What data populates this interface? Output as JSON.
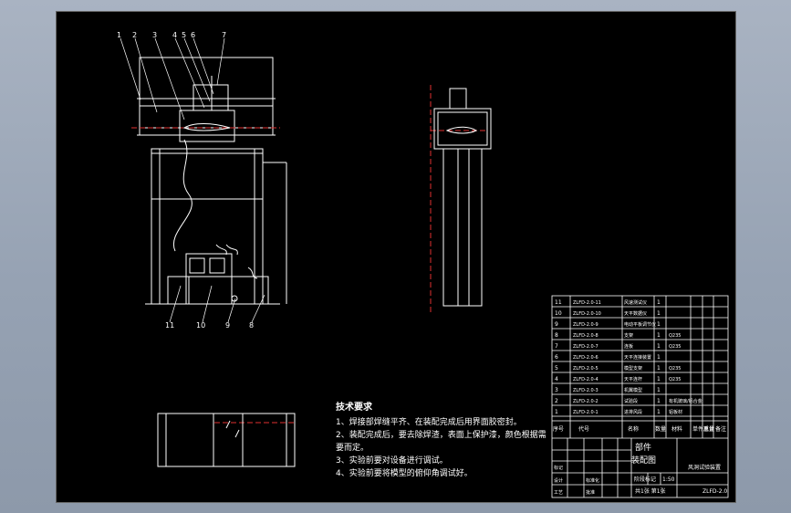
{
  "tech_requirements": {
    "title": "技术要求",
    "lines": [
      "1、焊接部焊缝平齐、在装配完成后用界面胶密封。",
      "2、装配完成后，要去除焊渣，表面上保护漆，颜色根据需",
      "要而定。",
      "3、实验前要对设备进行调试。",
      "4、实验前要将模型的俯仰角调试好。"
    ]
  },
  "bom": {
    "rows": [
      {
        "no": "11",
        "code": "ZLFD-2.0-11",
        "name": "风速测试仪",
        "qty": "1",
        "mat": ""
      },
      {
        "no": "10",
        "code": "ZLFD-2.0-10",
        "name": "天平数据仪",
        "qty": "1",
        "mat": ""
      },
      {
        "no": "9",
        "code": "ZLFD-2.0-9",
        "name": "电动平板调节仪",
        "qty": "1",
        "mat": ""
      },
      {
        "no": "8",
        "code": "ZLFD-2.0-8",
        "name": "支架",
        "qty": "1",
        "mat": "Q235"
      },
      {
        "no": "7",
        "code": "ZLFD-2.0-7",
        "name": "连板",
        "qty": "1",
        "mat": "Q235"
      },
      {
        "no": "6",
        "code": "ZLFD-2.0-6",
        "name": "天平连接装置",
        "qty": "1",
        "mat": ""
      },
      {
        "no": "5",
        "code": "ZLFD-2.0-5",
        "name": "模型支架",
        "qty": "1",
        "mat": "Q235"
      },
      {
        "no": "4",
        "code": "ZLFD-2.0-4",
        "name": "天平连杆",
        "qty": "1",
        "mat": "Q235"
      },
      {
        "no": "3",
        "code": "ZLFD-2.0-3",
        "name": "机翼模型",
        "qty": "1",
        "mat": ""
      },
      {
        "no": "2",
        "code": "ZLFD-2.0-2",
        "name": "试验段",
        "qty": "1",
        "mat": "有机玻璃/铝合金"
      },
      {
        "no": "1",
        "code": "ZLFD-2.0-1",
        "name": "进排风段",
        "qty": "1",
        "mat": "铝板材"
      }
    ],
    "header": {
      "no": "序号",
      "code": "代号",
      "name": "名称",
      "qty": "数量",
      "mat": "材料",
      "unit_weight": "单件重量",
      "total_weight": "总计",
      "remark": "备注"
    }
  },
  "title_block": {
    "part_label": "部件",
    "assembly": "装配图",
    "project": "风洞试验装置",
    "drawing_no": "ZLFD-2.0",
    "sheet": "共1张 第1张",
    "scale_label": "比例",
    "scale": "1:50",
    "weight_label": "重量",
    "designer_label": "设计",
    "process_label": "工艺",
    "approve_label": "批准",
    "standard_label": "标准化",
    "check_label": "审核",
    "mark_label": "标记",
    "count_label": "处数",
    "zone_label": "分区",
    "change_label": "更改文件号",
    "sign_label": "签名",
    "date_label": "年月日",
    "stage_label": "阶段标记"
  },
  "callouts": [
    "1",
    "2",
    "3",
    "4",
    "5",
    "6",
    "7",
    "8",
    "9",
    "10",
    "11"
  ]
}
